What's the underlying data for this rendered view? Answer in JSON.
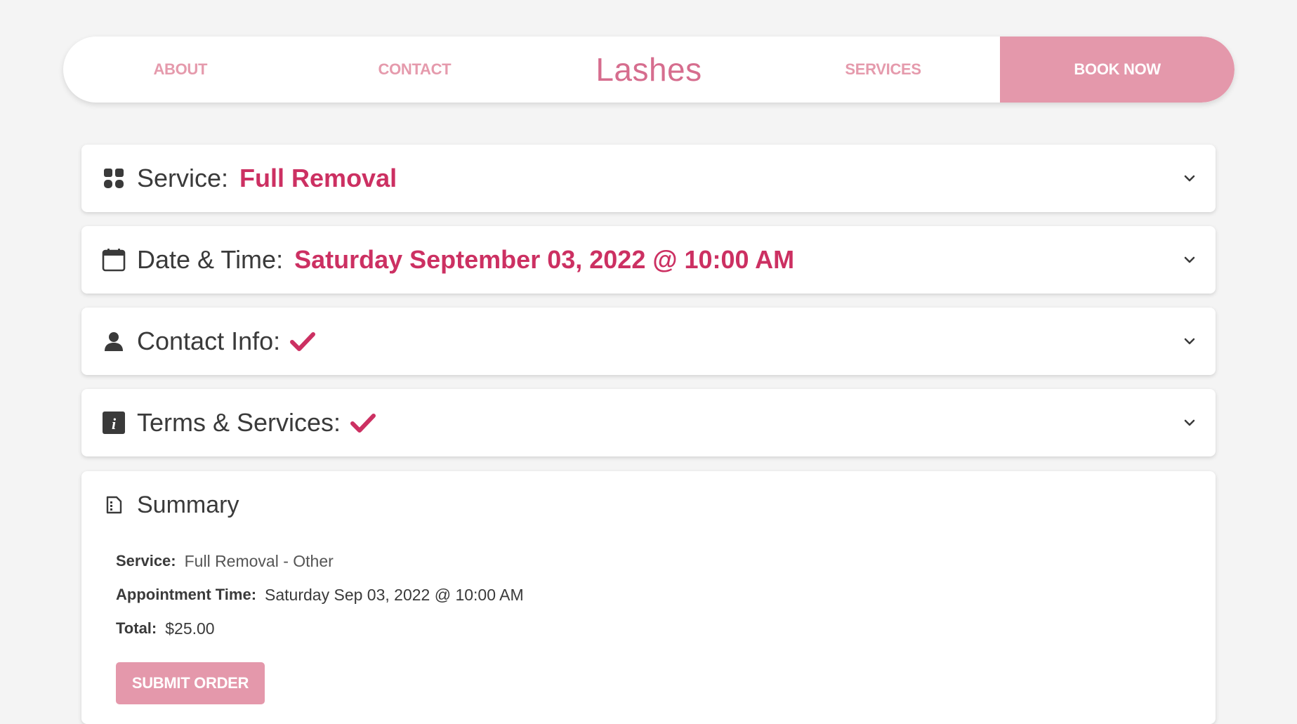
{
  "nav": {
    "about": "ABOUT",
    "contact": "CONTACT",
    "logo": "Lashes",
    "services": "SERVICES",
    "book_now": "BOOK NOW"
  },
  "accordion": {
    "service": {
      "label": "Service:",
      "value": "Full Removal",
      "icon": "grid-icon"
    },
    "datetime": {
      "label": "Date & Time:",
      "value": "Saturday September 03, 2022 @ 10:00 AM",
      "icon": "calendar-icon"
    },
    "contact": {
      "label": "Contact Info:",
      "complete": true,
      "icon": "person-icon"
    },
    "terms": {
      "label": "Terms & Services:",
      "complete": true,
      "icon": "info-icon"
    }
  },
  "summary": {
    "title": "Summary",
    "icon": "document-icon",
    "rows": [
      {
        "label": "Service:",
        "value": "Full Removal - Other"
      },
      {
        "label": "Appointment Time:",
        "value": "Saturday Sep 03, 2022 @ 10:00 AM"
      },
      {
        "label": "Total:",
        "value": "$25.00"
      }
    ],
    "submit_label": "SUBMIT ORDER"
  },
  "colors": {
    "accent": "#cc3062",
    "nav_pink": "#e59aac",
    "button_pink": "#e498ab",
    "background": "#f4f4f4",
    "text": "#3a3a3a"
  }
}
